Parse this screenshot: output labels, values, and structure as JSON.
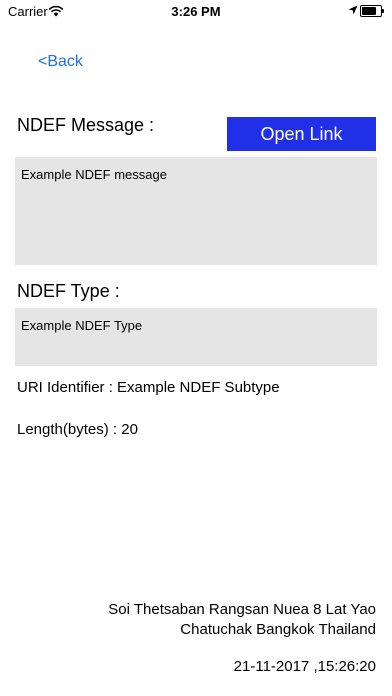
{
  "status_bar": {
    "carrier": "Carrier",
    "time": "3:26 PM",
    "icons": [
      "wifi-icon",
      "location-arrow-icon",
      "battery-icon"
    ]
  },
  "nav": {
    "back_label": "<Back"
  },
  "ndef_message": {
    "label": "NDEF Message :",
    "value": "Example NDEF message",
    "open_link_label": "Open Link"
  },
  "ndef_type": {
    "label": "NDEF Type :",
    "value": "Example NDEF Type"
  },
  "uri_identifier": "URI Identifier : Example NDEF Subtype",
  "length": "Length(bytes) : 20",
  "footer": {
    "address_line1": "Soi Thetsaban Rangsan Nuea 8 Lat Yao",
    "address_line2": "Chatuchak Bangkok Thailand",
    "datetime": "21-11-2017 ,15:26:20"
  },
  "colors": {
    "link": "#1e6fe0",
    "button_bg": "#2130e6",
    "field_bg": "#e5e5e5"
  },
  "battery_level": 0.9
}
